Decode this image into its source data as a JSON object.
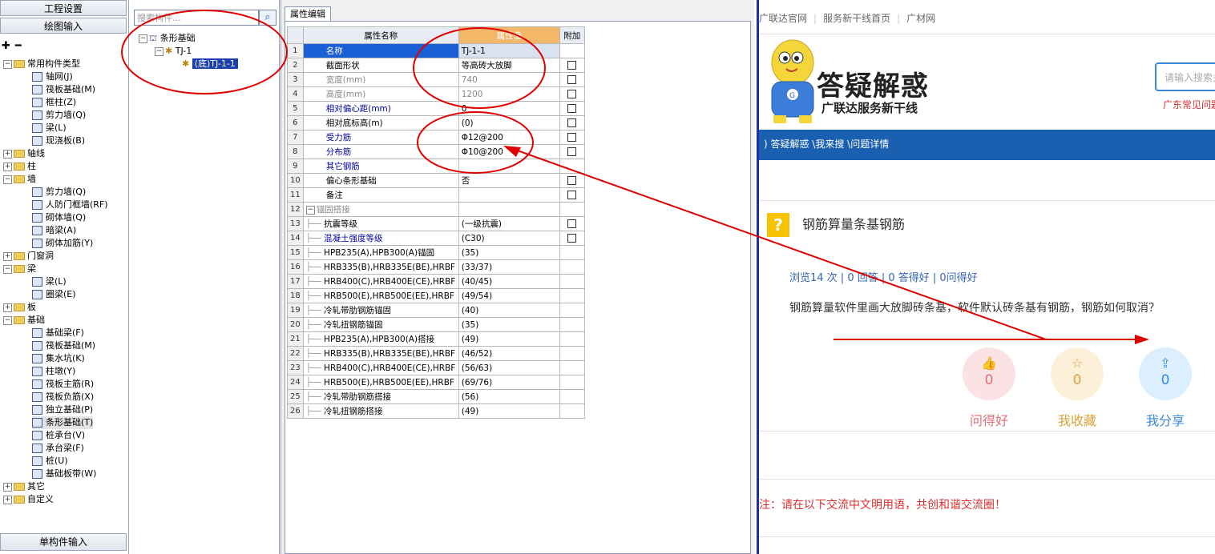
{
  "left_panel": {
    "project_settings": "工程设置",
    "drawing_input": "绘图输入",
    "single_input": "单构件输入",
    "tree": [
      {
        "label": "常用构件类型",
        "level": 0,
        "type": "folder",
        "expanded": true
      },
      {
        "label": "轴网(J)",
        "level": 2,
        "type": "item"
      },
      {
        "label": "筏板基础(M)",
        "level": 2,
        "type": "item"
      },
      {
        "label": "框柱(Z)",
        "level": 2,
        "type": "item"
      },
      {
        "label": "剪力墙(Q)",
        "level": 2,
        "type": "item"
      },
      {
        "label": "梁(L)",
        "level": 2,
        "type": "item"
      },
      {
        "label": "现浇板(B)",
        "level": 2,
        "type": "item"
      },
      {
        "label": "轴线",
        "level": 0,
        "type": "folder",
        "expanded": false
      },
      {
        "label": "柱",
        "level": 0,
        "type": "folder",
        "expanded": false
      },
      {
        "label": "墙",
        "level": 0,
        "type": "folder",
        "expanded": true
      },
      {
        "label": "剪力墙(Q)",
        "level": 2,
        "type": "item"
      },
      {
        "label": "人防门框墙(RF)",
        "level": 2,
        "type": "item"
      },
      {
        "label": "砌体墙(Q)",
        "level": 2,
        "type": "item"
      },
      {
        "label": "暗梁(A)",
        "level": 2,
        "type": "item"
      },
      {
        "label": "砌体加筋(Y)",
        "level": 2,
        "type": "item"
      },
      {
        "label": "门窗洞",
        "level": 0,
        "type": "folder",
        "expanded": false
      },
      {
        "label": "梁",
        "level": 0,
        "type": "folder",
        "expanded": true
      },
      {
        "label": "梁(L)",
        "level": 2,
        "type": "item"
      },
      {
        "label": "圈梁(E)",
        "level": 2,
        "type": "item"
      },
      {
        "label": "板",
        "level": 0,
        "type": "folder",
        "expanded": false
      },
      {
        "label": "基础",
        "level": 0,
        "type": "folder",
        "expanded": true
      },
      {
        "label": "基础梁(F)",
        "level": 2,
        "type": "item"
      },
      {
        "label": "筏板基础(M)",
        "level": 2,
        "type": "item"
      },
      {
        "label": "集水坑(K)",
        "level": 2,
        "type": "item"
      },
      {
        "label": "柱墩(Y)",
        "level": 2,
        "type": "item"
      },
      {
        "label": "筏板主筋(R)",
        "level": 2,
        "type": "item"
      },
      {
        "label": "筏板负筋(X)",
        "level": 2,
        "type": "item"
      },
      {
        "label": "独立基础(P)",
        "level": 2,
        "type": "item"
      },
      {
        "label": "条形基础(T)",
        "level": 2,
        "type": "item",
        "selected": true
      },
      {
        "label": "桩承台(V)",
        "level": 2,
        "type": "item"
      },
      {
        "label": "承台梁(F)",
        "level": 2,
        "type": "item"
      },
      {
        "label": "桩(U)",
        "level": 2,
        "type": "item"
      },
      {
        "label": "基础板带(W)",
        "level": 2,
        "type": "item"
      },
      {
        "label": "其它",
        "level": 0,
        "type": "folder",
        "expanded": false
      },
      {
        "label": "自定义",
        "level": 0,
        "type": "folder",
        "expanded": false
      }
    ]
  },
  "mid_panel": {
    "search_placeholder": "搜索构件...",
    "tree": [
      {
        "label": "条形基础",
        "level": 0
      },
      {
        "label": "TJ-1",
        "level": 1
      },
      {
        "label": "(底)TJ-1-1",
        "level": 2,
        "selected": true
      }
    ]
  },
  "prop_panel": {
    "tab": "属性编辑",
    "headers": {
      "name": "属性名称",
      "value": "属性值",
      "extra": "附加"
    },
    "rows": [
      {
        "n": "1",
        "name": "名称",
        "value": "TJ-1-1",
        "cb": false,
        "style": "sel"
      },
      {
        "n": "2",
        "name": "截面形状",
        "value": "等高砖大放脚",
        "cb": true,
        "style": ""
      },
      {
        "n": "3",
        "name": "宽度(mm)",
        "value": "740",
        "cb": true,
        "style": "gray"
      },
      {
        "n": "4",
        "name": "高度(mm)",
        "value": "1200",
        "cb": true,
        "style": "gray"
      },
      {
        "n": "5",
        "name": "相对偏心距(mm)",
        "value": "0",
        "cb": true,
        "style": "blue"
      },
      {
        "n": "6",
        "name": "相对底标高(m)",
        "value": "(0)",
        "cb": true,
        "style": ""
      },
      {
        "n": "7",
        "name": "受力筋",
        "value": "Φ12@200",
        "cb": true,
        "style": "blue"
      },
      {
        "n": "8",
        "name": "分布筋",
        "value": "Φ10@200",
        "cb": true,
        "style": "blue"
      },
      {
        "n": "9",
        "name": "其它钢筋",
        "value": "",
        "cb": false,
        "style": "blue"
      },
      {
        "n": "10",
        "name": "偏心条形基础",
        "value": "否",
        "cb": true,
        "style": ""
      },
      {
        "n": "11",
        "name": "备注",
        "value": "",
        "cb": true,
        "style": ""
      },
      {
        "n": "12",
        "name": "锚固搭接",
        "value": "",
        "cb": false,
        "style": "group"
      },
      {
        "n": "13",
        "name": "抗震等级",
        "value": "(一级抗震)",
        "cb": true,
        "style": "sub"
      },
      {
        "n": "14",
        "name": "混凝土强度等级",
        "value": "(C30)",
        "cb": true,
        "style": "subblue"
      },
      {
        "n": "15",
        "name": "HPB235(A),HPB300(A)锚固",
        "value": "(35)",
        "cb": false,
        "style": "sub"
      },
      {
        "n": "16",
        "name": "HRB335(B),HRB335E(BE),HRBF",
        "value": "(33/37)",
        "cb": false,
        "style": "sub"
      },
      {
        "n": "17",
        "name": "HRB400(C),HRB400E(CE),HRBF",
        "value": "(40/45)",
        "cb": false,
        "style": "sub"
      },
      {
        "n": "18",
        "name": "HRB500(E),HRB500E(EE),HRBF",
        "value": "(49/54)",
        "cb": false,
        "style": "sub"
      },
      {
        "n": "19",
        "name": "冷轧带肋钢筋锚固",
        "value": "(40)",
        "cb": false,
        "style": "sub"
      },
      {
        "n": "20",
        "name": "冷轧扭钢筋锚固",
        "value": "(35)",
        "cb": false,
        "style": "sub"
      },
      {
        "n": "21",
        "name": "HPB235(A),HPB300(A)搭接",
        "value": "(49)",
        "cb": false,
        "style": "sub"
      },
      {
        "n": "22",
        "name": "HRB335(B),HRB335E(BE),HRBF",
        "value": "(46/52)",
        "cb": false,
        "style": "sub"
      },
      {
        "n": "23",
        "name": "HRB400(C),HRB400E(CE),HRBF",
        "value": "(56/63)",
        "cb": false,
        "style": "sub"
      },
      {
        "n": "24",
        "name": "HRB500(E),HRB500E(EE),HRBF",
        "value": "(69/76)",
        "cb": false,
        "style": "sub"
      },
      {
        "n": "25",
        "name": "冷轧带肋钢筋搭接",
        "value": "(56)",
        "cb": false,
        "style": "sub"
      },
      {
        "n": "26",
        "name": "冷轧扭钢筋搭接",
        "value": "(49)",
        "cb": false,
        "style": "sub"
      }
    ]
  },
  "web_panel": {
    "top_links": [
      "广联达官网",
      "服务新干线首页",
      "广材网"
    ],
    "logo_title": "答疑解惑",
    "logo_subtitle": "广联达服务新干线",
    "search_placeholder": "请输入搜索关",
    "red_link": "广东常见问题",
    "breadcrumb": ") 答疑解惑 \\我来搜 \\问题详情",
    "question_title": "钢筋算量条基钢筋",
    "stats": "浏览14 次 | 0 回答 | 0 答得好 | 0问得好",
    "question_text": "钢筋算量软件里画大放脚砖条基，软件默认砖条基有钢筋，钢筋如何取消？",
    "actions": [
      {
        "label": "问得好",
        "count": "0",
        "icon": "thumbs-up-icon",
        "color": "#e0707a",
        "bg": "#fbe3e5"
      },
      {
        "label": "我收藏",
        "count": "0",
        "icon": "star-icon",
        "color": "#d9a23a",
        "bg": "#fdf0d8"
      },
      {
        "label": "我分享",
        "count": "0",
        "icon": "share-icon",
        "color": "#3a8ad8",
        "bg": "#dcefff"
      }
    ],
    "notice": "注：请在以下交流中文明用语，共创和谐交流圈！"
  },
  "colors": {
    "annotation": "#e00000",
    "banner": "#1a5fb0",
    "accent_blue": "#1b2fa8"
  }
}
